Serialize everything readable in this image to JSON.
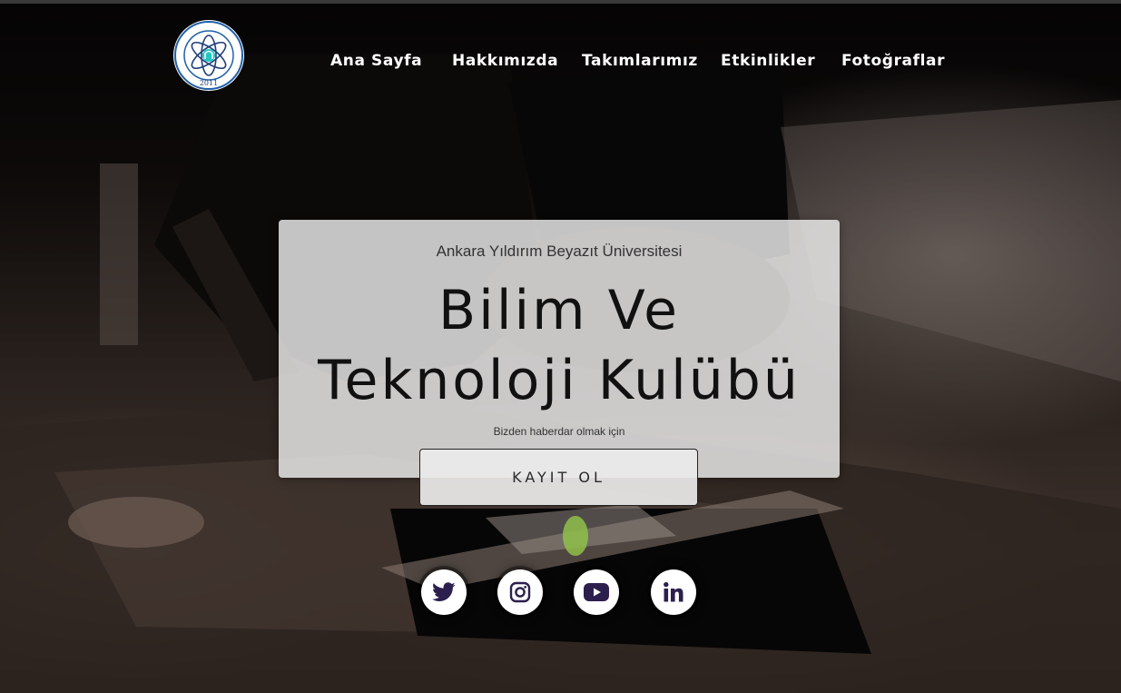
{
  "header": {
    "logo": {
      "icon": "atom-logo-icon",
      "ring_text": "YBU SCIENCE & TECHNOLOGY CLUB",
      "year": "2011"
    },
    "nav": [
      {
        "label": "Ana Sayfa"
      },
      {
        "label": "Hakkımızda"
      },
      {
        "label": "Takımlarımız"
      },
      {
        "label": "Etkinlikler"
      },
      {
        "label": "Fotoğraflar"
      }
    ]
  },
  "hero": {
    "subtitle": "Ankara Yıldırım Beyazıt Üniversitesi",
    "title_line1": "Bilim Ve",
    "title_line2": "Teknoloji Kulübü",
    "note": "Bizden haberdar olmak için",
    "button_label": "KAYIT OL"
  },
  "socials": [
    {
      "icon": "twitter-icon"
    },
    {
      "icon": "instagram-icon"
    },
    {
      "icon": "youtube-icon"
    },
    {
      "icon": "linkedin-icon"
    }
  ],
  "colors": {
    "icon_color": "#2d1f4d",
    "nav_text": "#ffffff",
    "card_bg": "#eeeeee",
    "logo_blue": "#1f5fa8",
    "logo_teal": "#22c6c0"
  }
}
